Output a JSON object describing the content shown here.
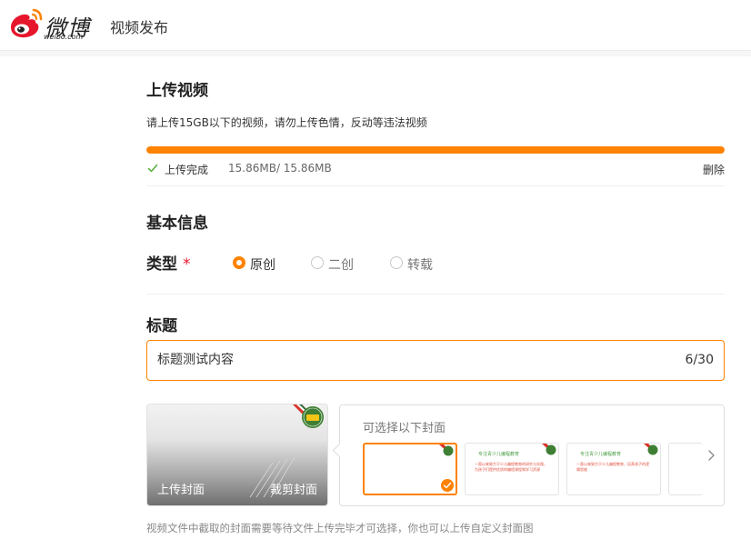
{
  "header": {
    "logo_text": "微博",
    "logo_domain": "weibo.com",
    "page_title": "视频发布"
  },
  "upload": {
    "section_title": "上传视频",
    "description": "请上传15GB以下的视频，请勿上传色情，反动等违法视频",
    "progress_percent": 100,
    "status_text": "上传完成",
    "size_text": "15.86MB/ 15.86MB",
    "delete_label": "删除"
  },
  "basic_info": {
    "section_title": "基本信息",
    "type_label": "类型",
    "required_mark": "*",
    "type_options": [
      {
        "label": "原创",
        "checked": true
      },
      {
        "label": "二创",
        "checked": false
      },
      {
        "label": "转载",
        "checked": false
      }
    ]
  },
  "title_field": {
    "section_title": "标题",
    "value": "标题测试内容",
    "count": "6/30"
  },
  "cover": {
    "upload_label": "上传封面",
    "crop_label": "裁剪封面",
    "picker_hint": "可选择以下封面",
    "thumbs": [
      {
        "selected": true,
        "head": "",
        "body": ""
      },
      {
        "selected": false,
        "head": "专注青少儿编程教育",
        "body": "一直以来致力于少儿编程教育的研究与实践，为孩子们提供优质的编程课程和学习资源"
      },
      {
        "selected": false,
        "head": "专注青少儿编程教育",
        "body": "一直以来致力于少儿编程教育，培养孩子的逻辑思维"
      },
      {
        "selected": false,
        "head": "",
        "body": ""
      }
    ],
    "footnote": "视频文件中截取的封面需要等待文件上传完毕才可选择，你也可以上传自定义封面图"
  },
  "colors": {
    "accent": "#ff8200",
    "required": "#e6162d",
    "brand_red": "#e6162d",
    "success": "#52b23a"
  },
  "icons": {
    "logo": "weibo-eye-icon",
    "status": "check-icon",
    "next": "chevron-right-icon",
    "selected": "check-circle-icon"
  }
}
